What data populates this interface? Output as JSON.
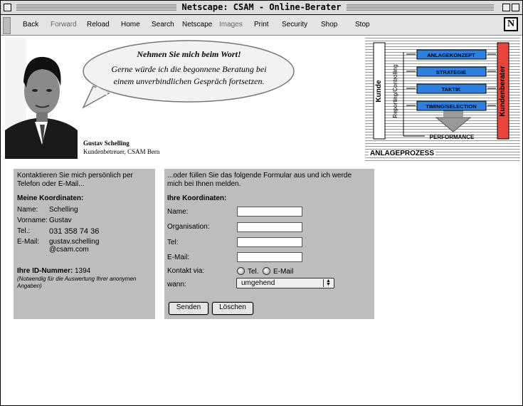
{
  "window": {
    "title": "Netscape: CSAM - Online-Berater"
  },
  "toolbar": {
    "back": "Back",
    "forward": "Forward",
    "reload": "Reload",
    "home": "Home",
    "search": "Search",
    "netscape": "Netscape",
    "images": "Images",
    "print": "Print",
    "security": "Security",
    "shop": "Shop",
    "stop": "Stop",
    "logo": "N"
  },
  "banner": {
    "speech_line1": "Nehmen Sie mich beim Wort!",
    "speech_line2": "Gerne würde ich die begonnene Beratung bei",
    "speech_line3": "einem unverbindlichen Gespräch fortsetzen.",
    "person_name": "Gustav Schelling",
    "person_role": "Kundenbetreuer, CSAM Bern"
  },
  "diagram": {
    "left_label": "Kunde",
    "vertical_label": "Reporting/Controlling",
    "right_label": "Kundenberater",
    "steps": [
      "ANLAGEKONZEPT",
      "STRATEGIE",
      "TAKTIK",
      "TIMING/SELECTION"
    ],
    "bottom": "PERFORMANCE",
    "caption": "ANLAGEPROZESS"
  },
  "left_panel": {
    "intro": "Kontaktieren Sie mich persönlich per Telefon oder E-Mail...",
    "heading": "Meine Koordinaten:",
    "name_label": "Name:",
    "name_value": "Schelling",
    "vorname_label": "Vorname:",
    "vorname_value": "Gustav",
    "tel_label": "Tel.:",
    "tel_value": "031 358 74 36",
    "email_label": "E-Mail:",
    "email_value1": "gustav.schelling",
    "email_value2": "@csam.com",
    "id_label": "Ihre ID-Nummer:",
    "id_value": "1394",
    "id_note": "(Notwendig für die Auswertung Ihrer anonymen Angaben)"
  },
  "form": {
    "intro": "...oder füllen Sie das folgende Formular aus und ich werde mich bei Ihnen melden.",
    "heading": "Ihre Koordinaten:",
    "name_label": "Name:",
    "org_label": "Organisation:",
    "tel_label": "Tel:",
    "email_label": "E-Mail:",
    "contact_label": "Kontakt via:",
    "radio_tel": "Tel.",
    "radio_email": "E-Mail",
    "when_label": "wann:",
    "when_value": "umgehend",
    "submit": "Senden",
    "reset": "Löschen"
  },
  "colors": {
    "panel": "#bdbdbd",
    "step_box": "#2f7fe0",
    "advisor_box": "#e8453c"
  }
}
